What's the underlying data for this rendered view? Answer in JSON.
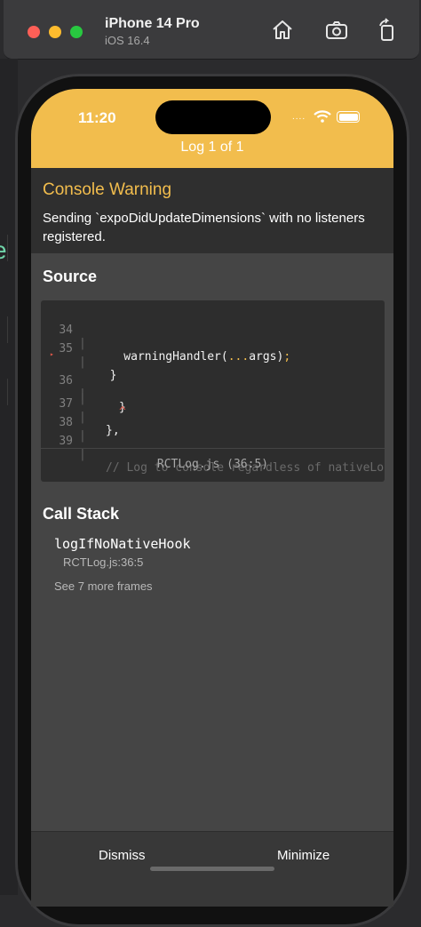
{
  "simulator": {
    "device_name": "iPhone 14 Pro",
    "os_version": "iOS 16.4",
    "buttons": {
      "home_icon": "home-icon",
      "screenshot_icon": "camera-icon",
      "rotate_icon": "rotate-icon"
    }
  },
  "status_bar": {
    "time": "11:20",
    "signal": "....",
    "wifi_icon": "wifi-icon",
    "battery_icon": "battery-icon"
  },
  "header": {
    "title": "Log 1 of 1",
    "color": "#f2bd4d"
  },
  "warning": {
    "title": "Console Warning",
    "message": "Sending `expoDidUpdateDimensions` with no listeners registered."
  },
  "source": {
    "title": "Source",
    "lines": [
      {
        "num": "34",
        "code": "    warningHandler(...args);"
      },
      {
        "num": "35",
        "code": "  }"
      },
      {
        "num": "36",
        "code": "}"
      },
      {
        "num": "",
        "code": "^"
      },
      {
        "num": "37",
        "code": "},"
      },
      {
        "num": "38",
        "code": ""
      },
      {
        "num": "39",
        "code": "// Log to console regardless of nativeLo"
      }
    ],
    "file": "RCTLog.js (36:5)"
  },
  "call_stack": {
    "title": "Call Stack",
    "frame": {
      "name": "logIfNoNativeHook",
      "location": "RCTLog.js:36:5"
    },
    "more": "See 7 more frames"
  },
  "footer": {
    "dismiss": "Dismiss",
    "minimize": "Minimize"
  }
}
